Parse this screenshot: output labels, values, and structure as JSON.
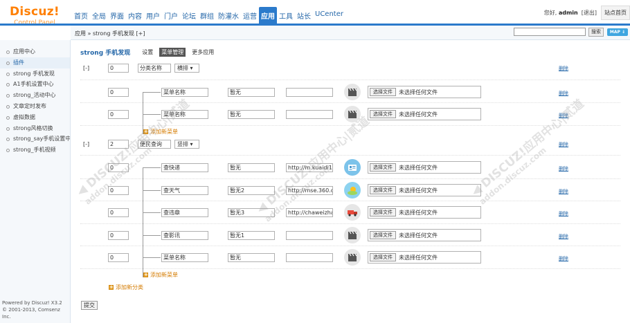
{
  "logo": {
    "main": "Discuz!",
    "sub": "Control Panel"
  },
  "nav": [
    "首页",
    "全局",
    "界面",
    "内容",
    "用户",
    "门户",
    "论坛",
    "群组",
    "防灌水",
    "运营",
    "应用",
    "工具",
    "站长",
    "UCenter"
  ],
  "nav_active_index": 10,
  "topright": {
    "greet_prefix": "您好,",
    "user": "admin",
    "logout": "[退出]",
    "home": "站点首页"
  },
  "breadcrumb": "应用 » strong 手机发现 [+]",
  "search_button": "搜索",
  "map_button": "MAP ⇓",
  "sidebar": {
    "items": [
      "应用中心",
      "插件",
      "strong 手机发现",
      "A1手机设置中心",
      "strong_活动中心",
      "文章定时发布",
      "虚拟数据",
      "strong风格切换",
      "strong_say手机设置中",
      "strong_手机视频"
    ],
    "active_index": 1,
    "footer_line1": "Powered by Discuz! X3.2",
    "footer_line2": "© 2001-2013, Comsenz Inc."
  },
  "main": {
    "plugin_title": "strong 手机发现",
    "tabs": [
      "设置",
      "菜单管理",
      "更多应用"
    ],
    "active_tab": 1,
    "categories": [
      {
        "toggle": "[-]",
        "order": "0",
        "name": "分类名称",
        "layout": "横排 ▾",
        "delete": "删除",
        "add_menu": "添加新菜单",
        "menus": [
          {
            "order": "0",
            "name": "菜单名称",
            "desc": "暂无",
            "url": "",
            "icon": "clapper-icon",
            "file_btn": "选择文件",
            "file_text": "未选择任何文件",
            "delete": "删除"
          },
          {
            "order": "0",
            "name": "菜单名称",
            "desc": "暂无",
            "url": "",
            "icon": "clapper-icon",
            "file_btn": "选择文件",
            "file_text": "未选择任何文件",
            "delete": "删除"
          }
        ]
      },
      {
        "toggle": "[-]",
        "order": "2",
        "name": "便民查询",
        "layout": "竖排 ▾",
        "delete": "删除",
        "add_menu": "添加新菜单",
        "menus": [
          {
            "order": "0",
            "name": "查快递",
            "desc": "暂无",
            "url": "http://m.kuaidi1",
            "icon": "id-card-icon",
            "file_btn": "选择文件",
            "file_text": "未选择任何文件",
            "delete": "删除"
          },
          {
            "order": "0",
            "name": "查天气",
            "desc": "暂无2",
            "url": "http://mse.360.c",
            "icon": "weather-icon",
            "file_btn": "选择文件",
            "file_text": "未选择任何文件",
            "delete": "删除"
          },
          {
            "order": "0",
            "name": "查违章",
            "desc": "暂无3",
            "url": "http://chaweizha",
            "icon": "truck-icon",
            "file_btn": "选择文件",
            "file_text": "未选择任何文件",
            "delete": "删除"
          },
          {
            "order": "0",
            "name": "查影讯",
            "desc": "暂无1",
            "url": "",
            "icon": "clapper-icon",
            "file_btn": "选择文件",
            "file_text": "未选择任何文件",
            "delete": "删除"
          },
          {
            "order": "0",
            "name": "菜单名称",
            "desc": "暂无",
            "url": "",
            "icon": "clapper-icon",
            "file_btn": "选择文件",
            "file_text": "未选择任何文件",
            "delete": "删除"
          }
        ]
      }
    ],
    "add_category": "添加新分类",
    "submit": "提交"
  },
  "colors": {
    "accent": "#2b7acb",
    "brand": "#ff7f00",
    "link": "#2366a8"
  }
}
